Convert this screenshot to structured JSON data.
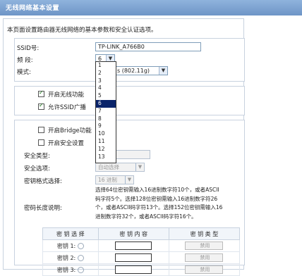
{
  "page_title": "无线网络基本设置",
  "description": "本页面设置路由器无线网络的基本参数和安全认证选项。",
  "ssid": {
    "label": "SSID号:",
    "value": "TP-LINK_A766B0"
  },
  "channel": {
    "label": "频 段:",
    "value": "6",
    "options": [
      "1",
      "2",
      "3",
      "4",
      "5",
      "6",
      "7",
      "8",
      "9",
      "10",
      "11",
      "12",
      "13"
    ],
    "highlighted": "6"
  },
  "mode": {
    "label": "模式:",
    "value": "s (802.11g)"
  },
  "checkboxes": [
    {
      "label": "开启无线功能",
      "checked": true
    },
    {
      "label": "允许SSID广播",
      "checked": true
    },
    {
      "label": "开启Bridge功能",
      "checked": false
    },
    {
      "label": "开启安全设置",
      "checked": false
    }
  ],
  "security": {
    "type_label": "安全类型:",
    "option_label": "安全选项:",
    "option_value": "自动选择",
    "format_label": "密钥格式选择:",
    "format_value": "16 进制",
    "length_label": "密码长度说明:",
    "length_text": [
      "选择64位密钥需输入16进制数字符10个，或者ASCII",
      "码字符5个。选择128位密钥需输入16进制数字符26",
      "个，或者ASCII码字符13个。选择152位密钥需输入16",
      "进制数字符32个，或者ASCII码字符16个。"
    ]
  },
  "key_table": {
    "headers": [
      "密 钥 选 择",
      "密 钥 内 容",
      "密 钥 类 型"
    ],
    "rows": [
      {
        "label": "密钥 1:",
        "type": "禁用"
      },
      {
        "label": "密钥 2:",
        "type": "禁用"
      },
      {
        "label": "密钥 3:",
        "type": "禁用"
      }
    ]
  }
}
